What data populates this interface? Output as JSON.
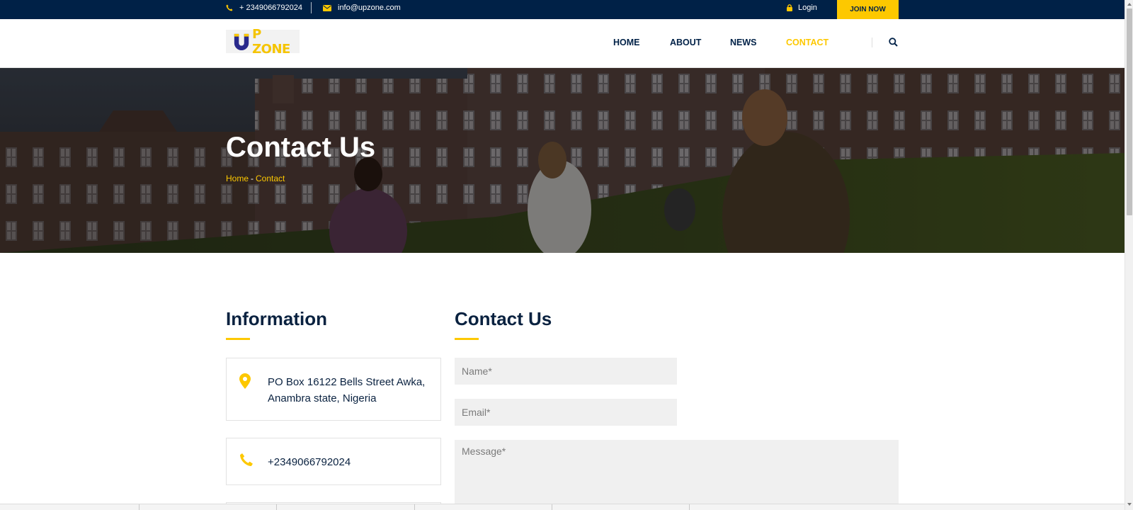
{
  "topbar": {
    "phone": "+ 2349066792024",
    "email": "info@upzone.com",
    "login": "Login",
    "join_now": "JOIN NOW"
  },
  "logo": {
    "text": "P ZONE"
  },
  "nav": {
    "items": [
      {
        "label": "HOME"
      },
      {
        "label": "ABOUT"
      },
      {
        "label": "NEWS"
      },
      {
        "label": "CONTACT"
      }
    ],
    "active": "CONTACT"
  },
  "banner": {
    "title": "Contact Us",
    "breadcrumb": {
      "home": "Home",
      "separator": "-",
      "current": "Contact"
    }
  },
  "information": {
    "title": "Information",
    "address_line1": "PO Box 16122 Bells Street Awka,",
    "address_line2": "Anambra state, Nigeria",
    "phone": "+2349066792024"
  },
  "contact_form": {
    "title": "Contact Us",
    "name_placeholder": "Name*",
    "email_placeholder": "Email*",
    "message_placeholder": "Message*"
  },
  "colors": {
    "navy": "#002147",
    "accent": "#fdc800",
    "field_bg": "#f0f0f0"
  },
  "icons": [
    "phone-icon",
    "mail-icon",
    "lock-icon",
    "search-icon",
    "map-marker-icon",
    "phone-icon"
  ]
}
